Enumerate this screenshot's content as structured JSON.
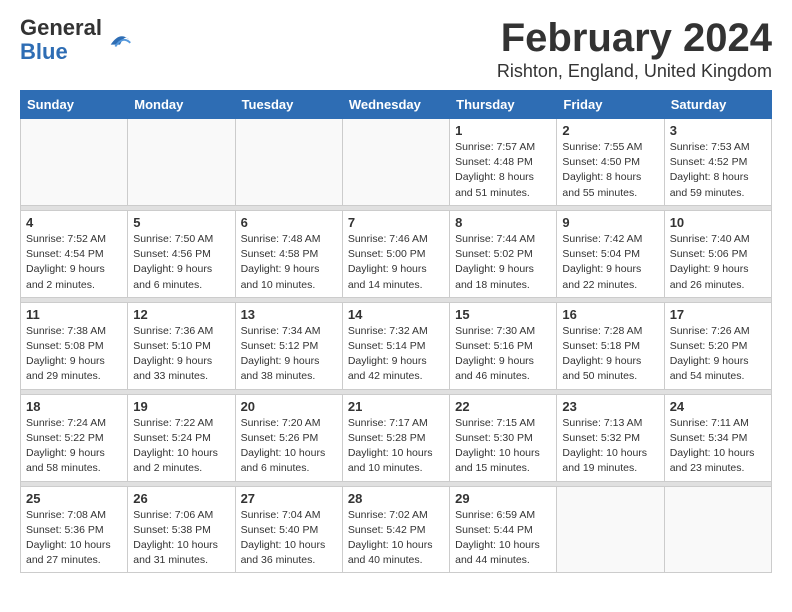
{
  "header": {
    "logo_general": "General",
    "logo_blue": "Blue",
    "title": "February 2024",
    "subtitle": "Rishton, England, United Kingdom"
  },
  "columns": [
    "Sunday",
    "Monday",
    "Tuesday",
    "Wednesday",
    "Thursday",
    "Friday",
    "Saturday"
  ],
  "weeks": [
    [
      {
        "day": "",
        "info": ""
      },
      {
        "day": "",
        "info": ""
      },
      {
        "day": "",
        "info": ""
      },
      {
        "day": "",
        "info": ""
      },
      {
        "day": "1",
        "info": "Sunrise: 7:57 AM\nSunset: 4:48 PM\nDaylight: 8 hours\nand 51 minutes."
      },
      {
        "day": "2",
        "info": "Sunrise: 7:55 AM\nSunset: 4:50 PM\nDaylight: 8 hours\nand 55 minutes."
      },
      {
        "day": "3",
        "info": "Sunrise: 7:53 AM\nSunset: 4:52 PM\nDaylight: 8 hours\nand 59 minutes."
      }
    ],
    [
      {
        "day": "4",
        "info": "Sunrise: 7:52 AM\nSunset: 4:54 PM\nDaylight: 9 hours\nand 2 minutes."
      },
      {
        "day": "5",
        "info": "Sunrise: 7:50 AM\nSunset: 4:56 PM\nDaylight: 9 hours\nand 6 minutes."
      },
      {
        "day": "6",
        "info": "Sunrise: 7:48 AM\nSunset: 4:58 PM\nDaylight: 9 hours\nand 10 minutes."
      },
      {
        "day": "7",
        "info": "Sunrise: 7:46 AM\nSunset: 5:00 PM\nDaylight: 9 hours\nand 14 minutes."
      },
      {
        "day": "8",
        "info": "Sunrise: 7:44 AM\nSunset: 5:02 PM\nDaylight: 9 hours\nand 18 minutes."
      },
      {
        "day": "9",
        "info": "Sunrise: 7:42 AM\nSunset: 5:04 PM\nDaylight: 9 hours\nand 22 minutes."
      },
      {
        "day": "10",
        "info": "Sunrise: 7:40 AM\nSunset: 5:06 PM\nDaylight: 9 hours\nand 26 minutes."
      }
    ],
    [
      {
        "day": "11",
        "info": "Sunrise: 7:38 AM\nSunset: 5:08 PM\nDaylight: 9 hours\nand 29 minutes."
      },
      {
        "day": "12",
        "info": "Sunrise: 7:36 AM\nSunset: 5:10 PM\nDaylight: 9 hours\nand 33 minutes."
      },
      {
        "day": "13",
        "info": "Sunrise: 7:34 AM\nSunset: 5:12 PM\nDaylight: 9 hours\nand 38 minutes."
      },
      {
        "day": "14",
        "info": "Sunrise: 7:32 AM\nSunset: 5:14 PM\nDaylight: 9 hours\nand 42 minutes."
      },
      {
        "day": "15",
        "info": "Sunrise: 7:30 AM\nSunset: 5:16 PM\nDaylight: 9 hours\nand 46 minutes."
      },
      {
        "day": "16",
        "info": "Sunrise: 7:28 AM\nSunset: 5:18 PM\nDaylight: 9 hours\nand 50 minutes."
      },
      {
        "day": "17",
        "info": "Sunrise: 7:26 AM\nSunset: 5:20 PM\nDaylight: 9 hours\nand 54 minutes."
      }
    ],
    [
      {
        "day": "18",
        "info": "Sunrise: 7:24 AM\nSunset: 5:22 PM\nDaylight: 9 hours\nand 58 minutes."
      },
      {
        "day": "19",
        "info": "Sunrise: 7:22 AM\nSunset: 5:24 PM\nDaylight: 10 hours\nand 2 minutes."
      },
      {
        "day": "20",
        "info": "Sunrise: 7:20 AM\nSunset: 5:26 PM\nDaylight: 10 hours\nand 6 minutes."
      },
      {
        "day": "21",
        "info": "Sunrise: 7:17 AM\nSunset: 5:28 PM\nDaylight: 10 hours\nand 10 minutes."
      },
      {
        "day": "22",
        "info": "Sunrise: 7:15 AM\nSunset: 5:30 PM\nDaylight: 10 hours\nand 15 minutes."
      },
      {
        "day": "23",
        "info": "Sunrise: 7:13 AM\nSunset: 5:32 PM\nDaylight: 10 hours\nand 19 minutes."
      },
      {
        "day": "24",
        "info": "Sunrise: 7:11 AM\nSunset: 5:34 PM\nDaylight: 10 hours\nand 23 minutes."
      }
    ],
    [
      {
        "day": "25",
        "info": "Sunrise: 7:08 AM\nSunset: 5:36 PM\nDaylight: 10 hours\nand 27 minutes."
      },
      {
        "day": "26",
        "info": "Sunrise: 7:06 AM\nSunset: 5:38 PM\nDaylight: 10 hours\nand 31 minutes."
      },
      {
        "day": "27",
        "info": "Sunrise: 7:04 AM\nSunset: 5:40 PM\nDaylight: 10 hours\nand 36 minutes."
      },
      {
        "day": "28",
        "info": "Sunrise: 7:02 AM\nSunset: 5:42 PM\nDaylight: 10 hours\nand 40 minutes."
      },
      {
        "day": "29",
        "info": "Sunrise: 6:59 AM\nSunset: 5:44 PM\nDaylight: 10 hours\nand 44 minutes."
      },
      {
        "day": "",
        "info": ""
      },
      {
        "day": "",
        "info": ""
      }
    ]
  ]
}
